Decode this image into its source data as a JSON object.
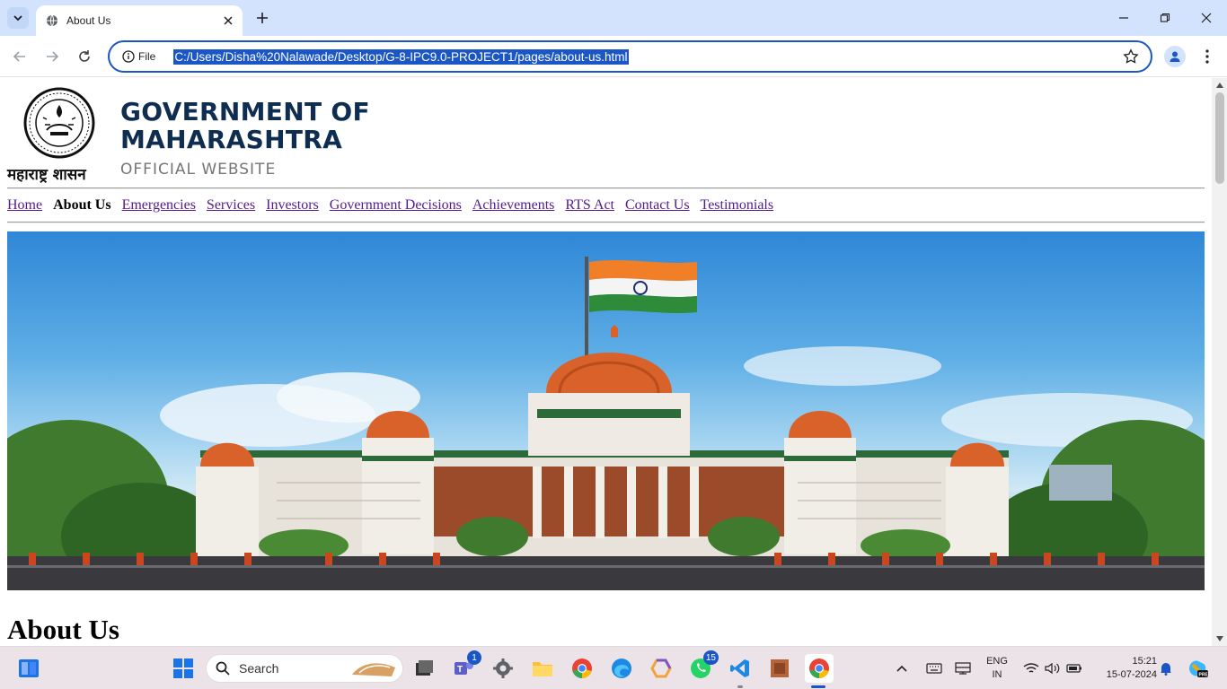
{
  "browser": {
    "tab_title": "About Us",
    "site_chip_label": "File",
    "url": "C:/Users/Disha%20Nalawade/Desktop/G-8-IPC9.0-PROJECT1/pages/about-us.html"
  },
  "page": {
    "logo_text": "महाराष्ट्र शासन",
    "brand_line1": "GOVERNMENT OF",
    "brand_line2": "MAHARASHTRA",
    "brand_sub": "OFFICIAL WEBSITE",
    "nav": {
      "home": "Home",
      "about": "About Us",
      "emergencies": "Emergencies",
      "services": "Services",
      "investors": "Investors",
      "gov_decisions": "Government Decisions",
      "achievements": "Achievements",
      "rts": "RTS Act",
      "contact": "Contact Us",
      "testimonials": "Testimonials"
    },
    "heading": "About Us"
  },
  "taskbar": {
    "search_label": "Search",
    "teams_badge": "1",
    "whatsapp_badge": "15",
    "lang_line1": "ENG",
    "lang_line2": "IN",
    "time": "15:21",
    "date": "15-07-2024"
  },
  "colors": {
    "brand_navy": "#0f2d50",
    "link_visited": "#551a8b",
    "url_highlight": "#1a56c5",
    "tab_strip": "#d3e3fd"
  }
}
